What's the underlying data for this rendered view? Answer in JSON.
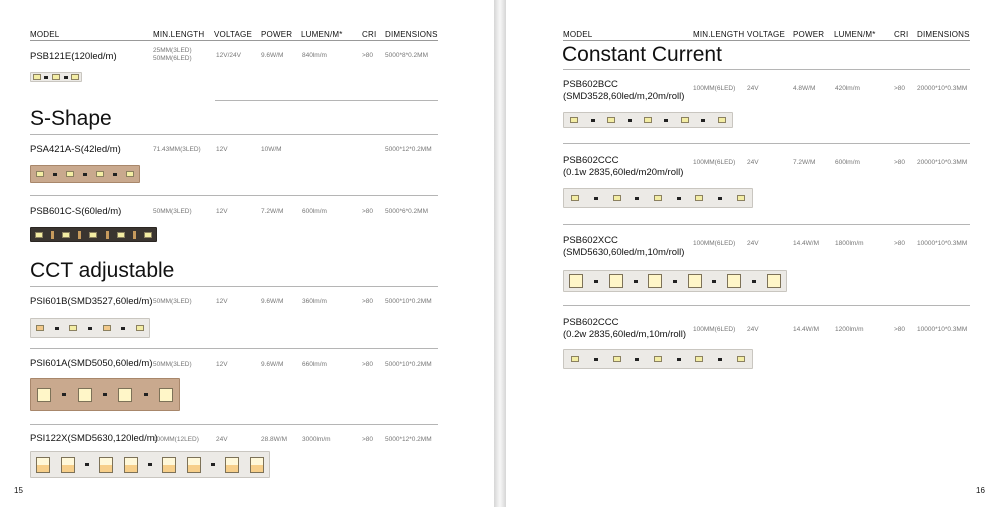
{
  "headers": {
    "model": "MODEL",
    "min_length": "MIN.LENGTH",
    "voltage": "VOLTAGE",
    "power": "POWER",
    "lumen": "LUMEN/M*",
    "cri": "CRI",
    "dimensions": "DIMENSIONS"
  },
  "left_page": {
    "page_number": "15",
    "sections": {
      "s_shape": "S-Shape",
      "cct": "CCT adjustable"
    },
    "products": [
      {
        "model": "PSB121E(120led/m)",
        "min_length": "25MM(3LED)\n50MM(6LED)",
        "voltage": "12V/24V",
        "power": "9.6W/M",
        "lumen": "840lm/m",
        "cri": ">80",
        "dimensions": "5000*8*0.2MM"
      },
      {
        "model": "PSA421A-S(42led/m)",
        "min_length": "71.43MM(3LED)",
        "voltage": "12V",
        "power": "10W/M",
        "lumen": "",
        "cri": "",
        "dimensions": "5000*12*0.2MM"
      },
      {
        "model": "PSB601C-S(60led/m)",
        "min_length": "50MM(3LED)",
        "voltage": "12V",
        "power": "7.2W/M",
        "lumen": "600lm/m",
        "cri": ">80",
        "dimensions": "5000*6*0.2MM"
      },
      {
        "model": "PSI601B(SMD3527,60led/m)",
        "min_length": "50MM(3LED)",
        "voltage": "12V",
        "power": "9.6W/M",
        "lumen": "360lm/m",
        "cri": ">80",
        "dimensions": "5000*10*0.2MM"
      },
      {
        "model": "PSI601A(SMD5050,60led/m)",
        "min_length": "50MM(3LED)",
        "voltage": "12V",
        "power": "9.6W/M",
        "lumen": "660lm/m",
        "cri": ">80",
        "dimensions": "5000*10*0.2MM"
      },
      {
        "model": "PSI122X(SMD5630,120led/m)",
        "min_length": "100MM(12LED)",
        "voltage": "24V",
        "power": "28.8W/M",
        "lumen": "3000lm/m",
        "cri": ">80",
        "dimensions": "5000*12*0.2MM"
      }
    ]
  },
  "right_page": {
    "page_number": "16",
    "sections": {
      "constant_current": "Constant Current"
    },
    "products": [
      {
        "model": "PSB602BCC",
        "model_sub": "(SMD3528,60led/m,20m/roll)",
        "min_length": "100MM(6LED)",
        "voltage": "24V",
        "power": "4.8W/M",
        "lumen": "420lm/m",
        "cri": ">80",
        "dimensions": "20000*10*0.3MM"
      },
      {
        "model": "PSB602CCC",
        "model_sub": "(0.1w 2835,60led/m20m/roll)",
        "min_length": "100MM(6LED)",
        "voltage": "24V",
        "power": "7.2W/M",
        "lumen": "600lm/m",
        "cri": ">80",
        "dimensions": "20000*10*0.3MM"
      },
      {
        "model": "PSB602XCC",
        "model_sub": "(SMD5630,60led/m,10m/roll)",
        "min_length": "100MM(6LED)",
        "voltage": "24V",
        "power": "14.4W/M",
        "lumen": "1800lm/m",
        "cri": ">80",
        "dimensions": "10000*10*0.3MM"
      },
      {
        "model": "PSB602CCC",
        "model_sub": "(0.2w 2835,60led/m,10m/roll)",
        "min_length": "100MM(6LED)",
        "voltage": "24V",
        "power": "14.4W/M",
        "lumen": "1200lm/m",
        "cri": ">80",
        "dimensions": "10000*10*0.3MM"
      }
    ]
  }
}
